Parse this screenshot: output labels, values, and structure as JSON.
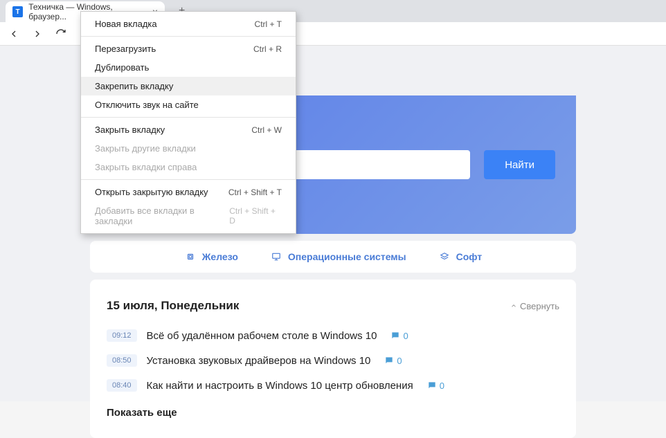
{
  "browser": {
    "tab": {
      "favicon_letter": "Т",
      "title": "Техничка — Windows, браузер..."
    },
    "new_tab_plus": "+"
  },
  "context_menu": [
    {
      "label": "Новая вкладка",
      "shortcut": "Ctrl + T",
      "disabled": false,
      "highlighted": false,
      "sep_after": true
    },
    {
      "label": "Перезагрузить",
      "shortcut": "Ctrl + R",
      "disabled": false,
      "highlighted": false
    },
    {
      "label": "Дублировать",
      "shortcut": "",
      "disabled": false,
      "highlighted": false
    },
    {
      "label": "Закрепить вкладку",
      "shortcut": "",
      "disabled": false,
      "highlighted": true
    },
    {
      "label": "Отключить звук на сайте",
      "shortcut": "",
      "disabled": false,
      "highlighted": false,
      "sep_after": true
    },
    {
      "label": "Закрыть вкладку",
      "shortcut": "Ctrl + W",
      "disabled": false,
      "highlighted": false
    },
    {
      "label": "Закрыть другие вкладки",
      "shortcut": "",
      "disabled": true,
      "highlighted": false
    },
    {
      "label": "Закрыть вкладки справа",
      "shortcut": "",
      "disabled": true,
      "highlighted": false,
      "sep_after": true
    },
    {
      "label": "Открыть закрытую вкладку",
      "shortcut": "Ctrl + Shift + T",
      "disabled": false,
      "highlighted": false
    },
    {
      "label": "Добавить все вкладки в закладки",
      "shortcut": "Ctrl + Shift + D",
      "disabled": true,
      "highlighted": false
    }
  ],
  "hero": {
    "search_button": "Найти"
  },
  "nav_tabs": {
    "hardware": "Железо",
    "os": "Операционные системы",
    "software": "Софт"
  },
  "feed": {
    "date": "15 июля, Понедельник",
    "collapse": "Свернуть",
    "articles": [
      {
        "time": "09:12",
        "title": "Всё об удалённом рабочем столе в Windows 10",
        "comments": "0"
      },
      {
        "time": "08:50",
        "title": "Установка звуковых драйверов на Windows 10",
        "comments": "0"
      },
      {
        "time": "08:40",
        "title": "Как найти и настроить в Windows 10 центр обновления",
        "comments": "0"
      }
    ],
    "show_more": "Показать еще"
  }
}
